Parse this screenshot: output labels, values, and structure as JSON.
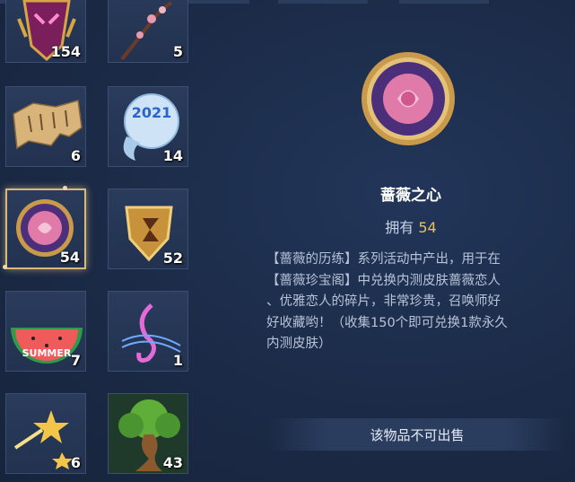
{
  "inventory": {
    "items": [
      {
        "icon": "demon-mask-icon",
        "count": "154"
      },
      {
        "icon": "plum-blossom-branch-icon",
        "count": "5"
      },
      {
        "icon": "torn-scroll-fragment-icon",
        "count": "6"
      },
      {
        "icon": "snow-orb-2021-icon",
        "count": "14",
        "badge_text": "2021"
      },
      {
        "icon": "rose-heart-medallion-icon",
        "count": "54",
        "selected": true
      },
      {
        "icon": "golden-shield-emblem-icon",
        "count": "52"
      },
      {
        "icon": "summer-watermelon-icon",
        "count": "7",
        "badge_text": "SUMMER"
      },
      {
        "icon": "music-note-treble-clef-icon",
        "count": "1"
      },
      {
        "icon": "shooting-stars-icon",
        "count": "6"
      },
      {
        "icon": "bonsai-tree-icon",
        "count": "43"
      }
    ]
  },
  "detail": {
    "icon": "rose-heart-medallion-icon",
    "name": "蔷薇之心",
    "owned_label": "拥有",
    "owned_count": "54",
    "description_lines": [
      "【蔷薇的历练】系列活动中产出，用于在",
      "【蔷薇珍宝阁】中兑换内测皮肤蔷薇恋人",
      "、优雅恋人的碎片，非常珍贵，召唤师好",
      "好收藏哟！（收集150个即可兑换1款永久",
      "内测皮肤）"
    ],
    "sell_status": "该物品不可出售"
  },
  "colors": {
    "background": "#1c2b45",
    "accent_gold": "#e7c15a",
    "selected_border": "#d9b87a"
  }
}
